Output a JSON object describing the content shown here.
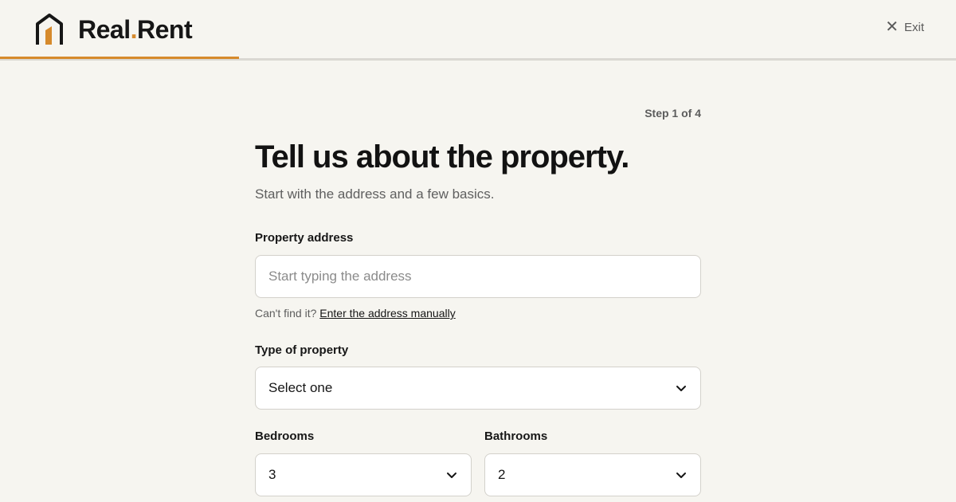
{
  "brand": {
    "name_part1": "Real",
    "dot": ".",
    "name_part2": "Rent",
    "accent_color": "#d68a2c"
  },
  "header": {
    "exit_label": "Exit",
    "progress_fraction": 0.25
  },
  "form": {
    "step_text": "Step 1 of 4",
    "title": "Tell us about the property.",
    "subtitle": "Start with the address and a few basics.",
    "address": {
      "label": "Property address",
      "placeholder": "Start typing the address",
      "help_prefix": "Can't find it?",
      "help_link": "Enter the address manually"
    },
    "property_type": {
      "label": "Type of property",
      "value": "Select one"
    },
    "bedrooms": {
      "label": "Bedrooms",
      "value": "3"
    },
    "bathrooms": {
      "label": "Bathrooms",
      "value": "2"
    }
  },
  "icons": {
    "logo": "house-logo-icon",
    "exit": "close-icon",
    "select": "chevron-down-icon"
  }
}
